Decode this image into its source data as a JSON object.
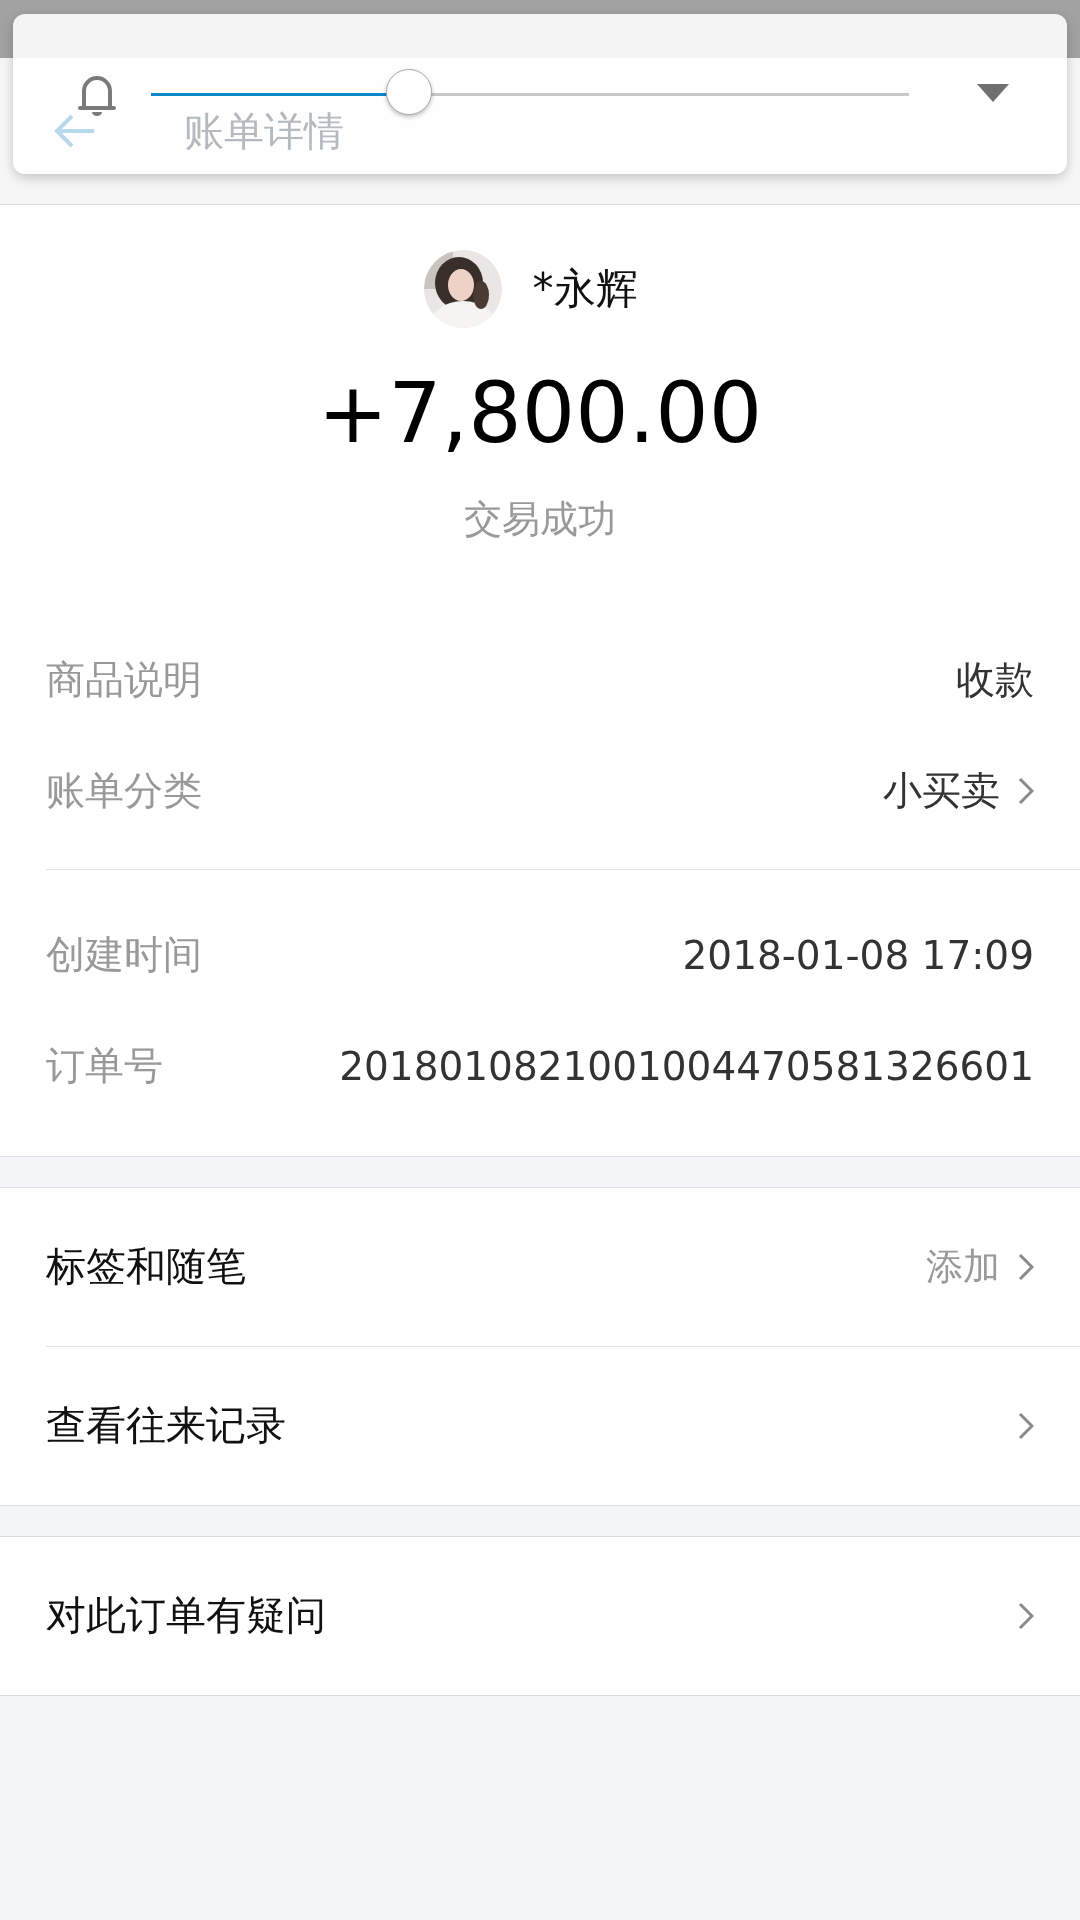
{
  "volume_panel": {
    "level": 0.34
  },
  "header": {
    "title": "账单详情"
  },
  "payee": {
    "name": "*永辉"
  },
  "amount": "+7,800.00",
  "status": "交易成功",
  "detail_groups": [
    {
      "items": [
        {
          "label": "商品说明",
          "value": "收款",
          "link": false
        },
        {
          "label": "账单分类",
          "value": "小买卖",
          "link": true
        }
      ]
    },
    {
      "items": [
        {
          "label": "创建时间",
          "value": "2018-01-08 17:09",
          "link": false
        },
        {
          "label": "订单号",
          "value": "2018010821001004470581326601",
          "link": false
        }
      ]
    }
  ],
  "action_groups": [
    {
      "items": [
        {
          "label": "标签和随笔",
          "value": "添加"
        },
        {
          "label": "查看往来记录"
        }
      ]
    },
    {
      "items": [
        {
          "label": "对此订单有疑问"
        }
      ]
    }
  ]
}
